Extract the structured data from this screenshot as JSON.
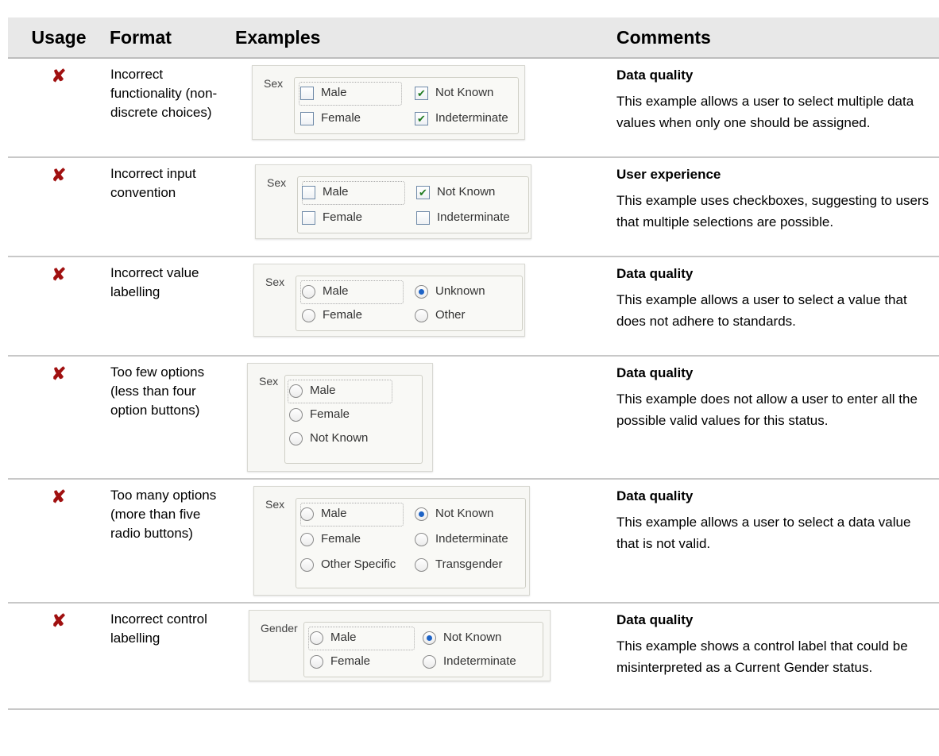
{
  "header": {
    "usage": "Usage",
    "format": "Format",
    "examples": "Examples",
    "comments": "Comments"
  },
  "rows": [
    {
      "format": "Incorrect functionality (non-discrete choices)",
      "comment_title": "Data quality",
      "comment_body": "This example allows a user to select multiple data values when only one should be assigned.",
      "example": {
        "legend": "Sex",
        "control": "checkbox",
        "options": [
          {
            "label": "Male",
            "checked": false
          },
          {
            "label": "Not Known",
            "checked": true
          },
          {
            "label": "Female",
            "checked": false
          },
          {
            "label": "Indeterminate",
            "checked": true
          }
        ]
      }
    },
    {
      "format": "Incorrect input convention",
      "comment_title": "User experience",
      "comment_body": "This example uses checkboxes, suggesting to users that multiple selections are possible.",
      "example": {
        "legend": "Sex",
        "control": "checkbox",
        "options": [
          {
            "label": "Male",
            "checked": false
          },
          {
            "label": "Not Known",
            "checked": true
          },
          {
            "label": "Female",
            "checked": false
          },
          {
            "label": "Indeterminate",
            "checked": false
          }
        ]
      }
    },
    {
      "format": "Incorrect value labelling",
      "comment_title": "Data quality",
      "comment_body": "This example allows a user to select a value that does not adhere to standards.",
      "example": {
        "legend": "Sex",
        "control": "radio",
        "options": [
          {
            "label": "Male",
            "checked": false
          },
          {
            "label": "Unknown",
            "checked": true
          },
          {
            "label": "Female",
            "checked": false
          },
          {
            "label": "Other",
            "checked": false
          }
        ]
      }
    },
    {
      "format": "Too few options (less than four option buttons)",
      "comment_title": "Data quality",
      "comment_body": "This example does not allow a user to enter all the possible valid values for this status.",
      "example": {
        "legend": "Sex",
        "control": "radio",
        "options": [
          {
            "label": "Male",
            "checked": false
          },
          {
            "label": "Female",
            "checked": false
          },
          {
            "label": "Not Known",
            "checked": false
          }
        ]
      }
    },
    {
      "format": "Too many options (more than five radio buttons)",
      "comment_title": "Data quality",
      "comment_body": "This example allows a user to select a data value that is not valid.",
      "example": {
        "legend": "Sex",
        "control": "radio",
        "options": [
          {
            "label": "Male",
            "checked": false
          },
          {
            "label": "Not Known",
            "checked": true
          },
          {
            "label": "Female",
            "checked": false
          },
          {
            "label": "Indeterminate",
            "checked": false
          },
          {
            "label": "Other Specific",
            "checked": false
          },
          {
            "label": "Transgender",
            "checked": false
          }
        ]
      }
    },
    {
      "format": "Incorrect control labelling",
      "comment_title": "Data quality",
      "comment_body": "This example shows a control label that could be misinterpreted as a Current Gender status.",
      "example": {
        "legend": "Gender",
        "control": "radio",
        "options": [
          {
            "label": "Male",
            "checked": false
          },
          {
            "label": "Not Known",
            "checked": true
          },
          {
            "label": "Female",
            "checked": false
          },
          {
            "label": "Indeterminate",
            "checked": false
          }
        ]
      }
    }
  ],
  "usage_icon": "cross-icon",
  "colors": {
    "cross": "#a01010",
    "header_bg": "#e8e8e8",
    "check": "#1f7a1f",
    "radio_dot": "#1d63c6"
  }
}
